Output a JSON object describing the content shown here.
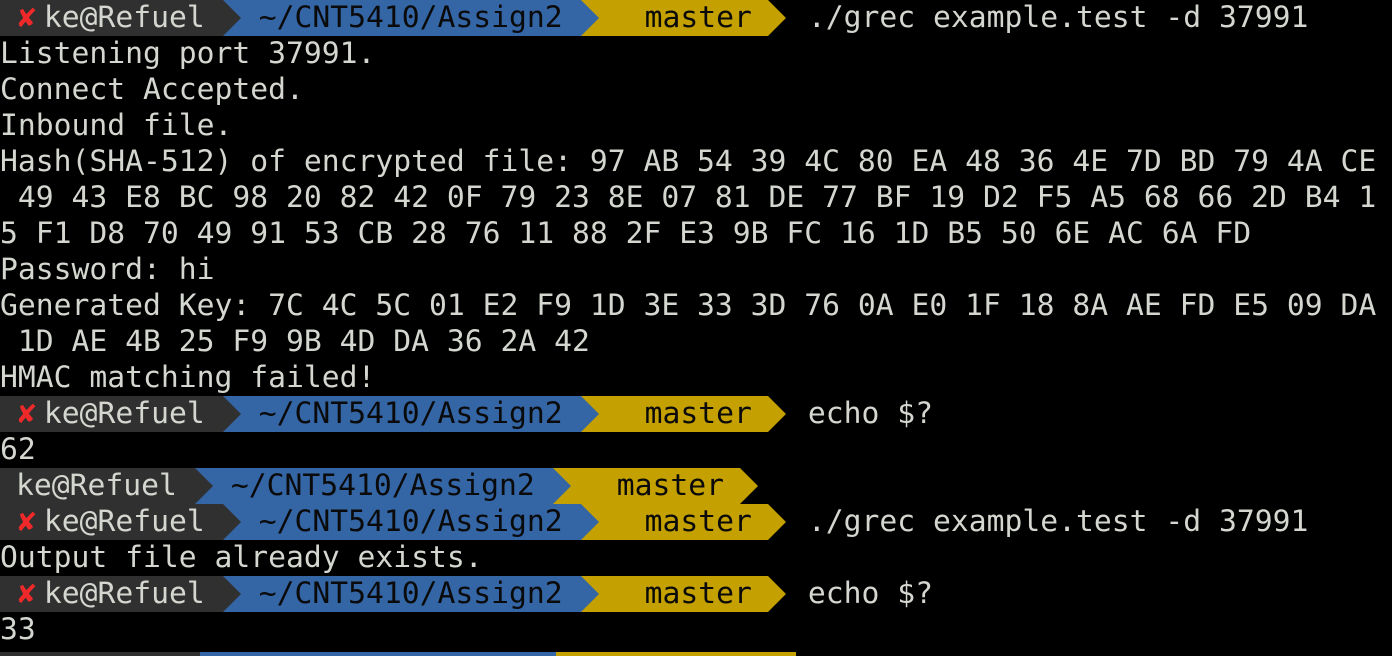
{
  "colors": {
    "background": "#000000",
    "foreground": "#d3d7cf",
    "user_segment": "#303030",
    "dir_segment": "#3465a4",
    "git_segment": "#c4a000",
    "error_mark": "#ef2929"
  },
  "prompt": {
    "user_host": "ke@Refuel",
    "cwd": "~/CNT5410/Assign2",
    "branch": "master",
    "error_icon": "✘",
    "branch_icon": "git-branch-icon"
  },
  "commands": {
    "c1": "./grec example.test -d 37991",
    "c2": "echo $?",
    "c3": "./grec example.test -d 37991",
    "c4": "echo $?"
  },
  "output": {
    "l1": "Listening port 37991.",
    "l2": "Connect Accepted.",
    "l3": "Inbound file.",
    "l4": "Hash(SHA-512) of encrypted file: 97 AB 54 39 4C 80 EA 48 36 4E 7D BD 79 4A CE",
    "l5": " 49 43 E8 BC 98 20 82 42 0F 79 23 8E 07 81 DE 77 BF 19 D2 F5 A5 68 66 2D B4 1",
    "l6": "5 F1 D8 70 49 91 53 CB 28 76 11 88 2F E3 9B FC 16 1D B5 50 6E AC 6A FD",
    "l7": "Password: hi",
    "l8": "Generated Key: 7C 4C 5C 01 E2 F9 1D 3E 33 3D 76 0A E0 1F 18 8A AE FD E5 09 DA",
    "l9": " 1D AE 4B 25 F9 9B 4D DA 36 2A 42",
    "l10": "HMAC matching failed!",
    "l11": "62",
    "l12": "Output file already exists.",
    "l13": "33"
  }
}
